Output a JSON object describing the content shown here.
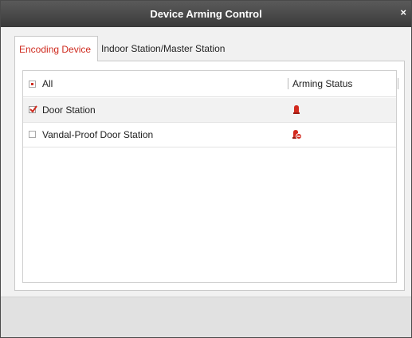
{
  "dialog": {
    "title": "Device Arming Control",
    "close_glyph": "×"
  },
  "tabs": [
    {
      "label": "Encoding Device",
      "active": true
    },
    {
      "label": "Indoor Station/Master Station",
      "active": false
    }
  ],
  "table": {
    "select_all_label": "All",
    "status_header": "Arming Status",
    "rows": [
      {
        "name": "Door Station",
        "checked": true,
        "status_icon": "alarm-armed-icon"
      },
      {
        "name": "Vandal-Proof Door Station",
        "checked": false,
        "status_icon": "alarm-disarmed-icon"
      }
    ]
  },
  "colors": {
    "accent": "#cf2b1f",
    "title_bar": "#444444"
  }
}
